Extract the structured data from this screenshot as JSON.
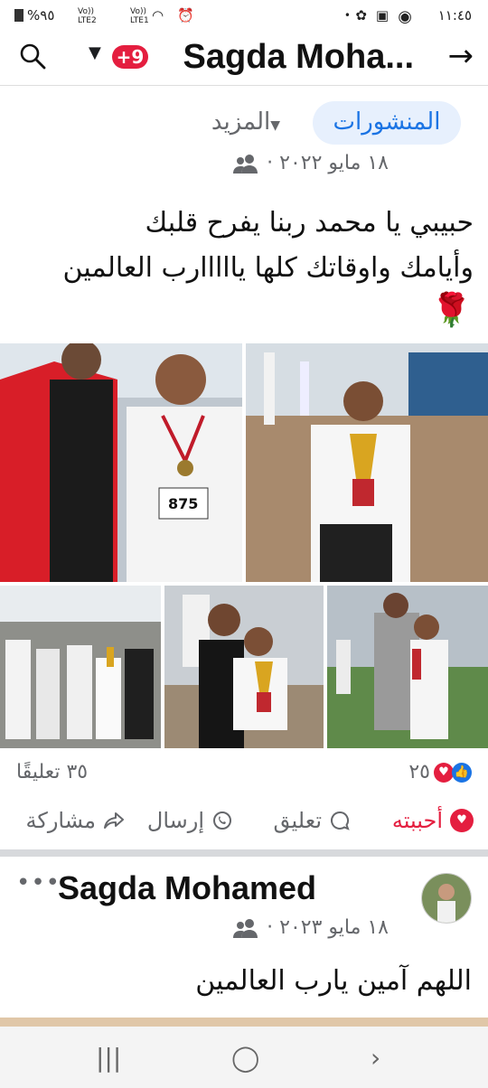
{
  "status_bar": {
    "time": "١١:٤٥",
    "battery": "%٩٥",
    "dot": "•",
    "lte1": "Vo)) LTE1",
    "lte2": "Vo)) LTE2"
  },
  "header": {
    "title": "Sagda Moha...",
    "notif_badge": "+9"
  },
  "tabs": {
    "posts": "المنشورات",
    "more": "المزيد"
  },
  "post": {
    "date": "١٨ مايو ٢٠٢٢ ·",
    "text_line1": "حبيبي يا محمد ربنا يفرح قلبك",
    "text_line2": "وأيامك واوقاتك كلها يااااارب العالمين",
    "emoji": "🌹",
    "bib_number": "875",
    "reactions_count": "٢٥",
    "comments_count": "٣٥ تعليقًا",
    "actions": {
      "like": "أحببته",
      "comment": "تعليق",
      "send": "إرسال",
      "share": "مشاركة"
    }
  },
  "post2": {
    "author": "Sagda Mohamed",
    "date": "١٨ مايو ٢٠٢٣ ·",
    "text": "اللهم آمين يارب العالمين",
    "menu": "•••"
  },
  "colors": {
    "accent": "#1b74e4",
    "love": "#e41e3f",
    "tab_bg": "#e7f0fd"
  },
  "icons": [
    "search-icon",
    "back-arrow-icon",
    "people-icon",
    "rose-emoji",
    "love-icon",
    "like-icon",
    "comment-icon",
    "whatsapp-icon",
    "share-icon"
  ]
}
